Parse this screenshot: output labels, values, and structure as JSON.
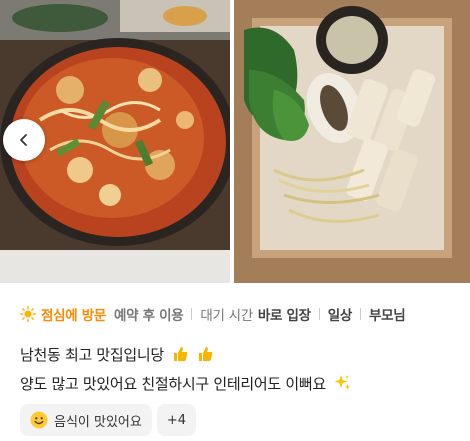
{
  "photos": {
    "left_alt_icon": "spicy-stir-fry-photo",
    "right_alt_icon": "bossam-steamed-pork-photo",
    "prev_icon": "chevron-left-icon"
  },
  "info": {
    "sun_icon": "sun-icon",
    "visit_time": "점심에 방문",
    "reservation": "예약 후 이용",
    "wait_label": "대기 시간",
    "wait_value": "바로 입장",
    "purpose": "일상",
    "companion": "부모님"
  },
  "review": {
    "line1": "남천동 최고 맛집입니당",
    "line2": "양도 많고 맛있어요 친절하시구 인테리어도 이뻐요"
  },
  "chips": {
    "keyword_label": "음식이 맛있어요",
    "more_label": "+4"
  },
  "colors": {
    "accent": "#ff8a00",
    "chip_bg": "#f3f3f3"
  }
}
